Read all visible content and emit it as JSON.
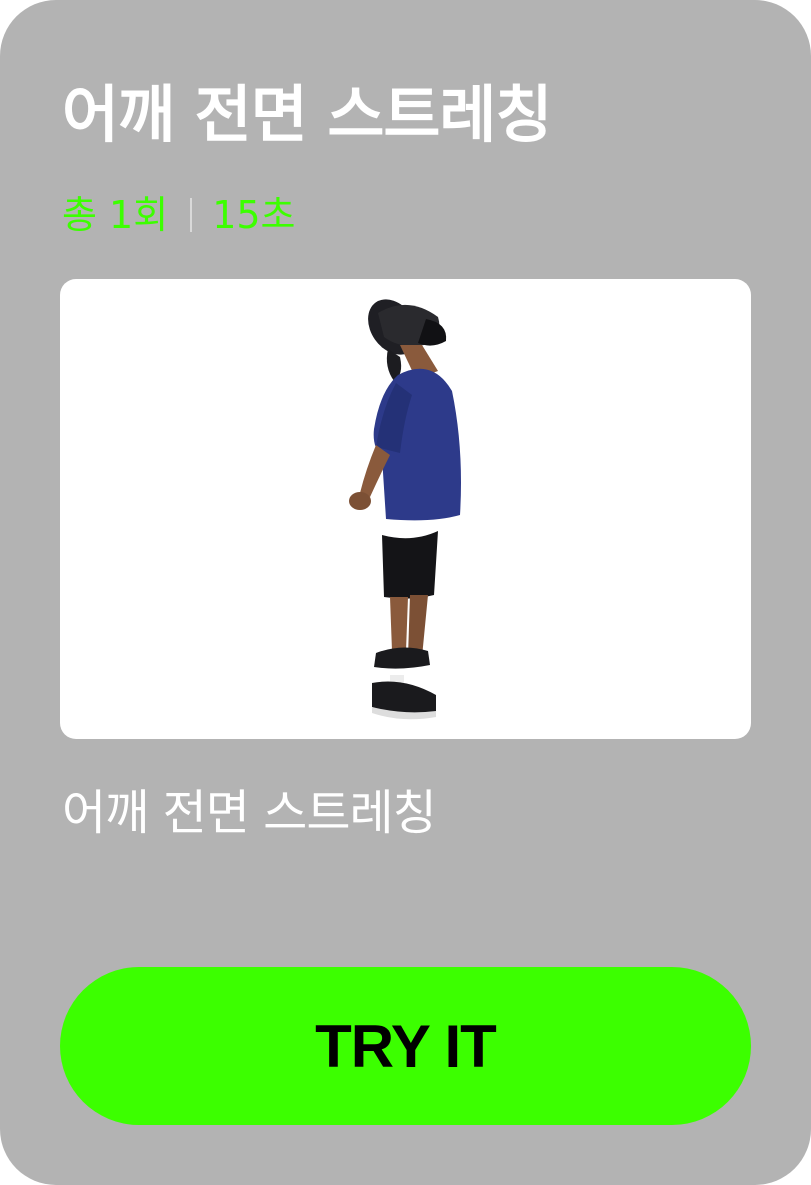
{
  "exercise": {
    "title": "어깨 전면 스트레칭",
    "sets": "총 1회",
    "duration": "15초",
    "description": "어깨 전면 스트레칭",
    "image_icon": "person-stretch-icon"
  },
  "cta": {
    "label": "TRY IT"
  },
  "colors": {
    "card_background": "#b3b3b3",
    "accent": "#3cff00",
    "title_text": "#ffffff",
    "button_text": "#000000"
  }
}
